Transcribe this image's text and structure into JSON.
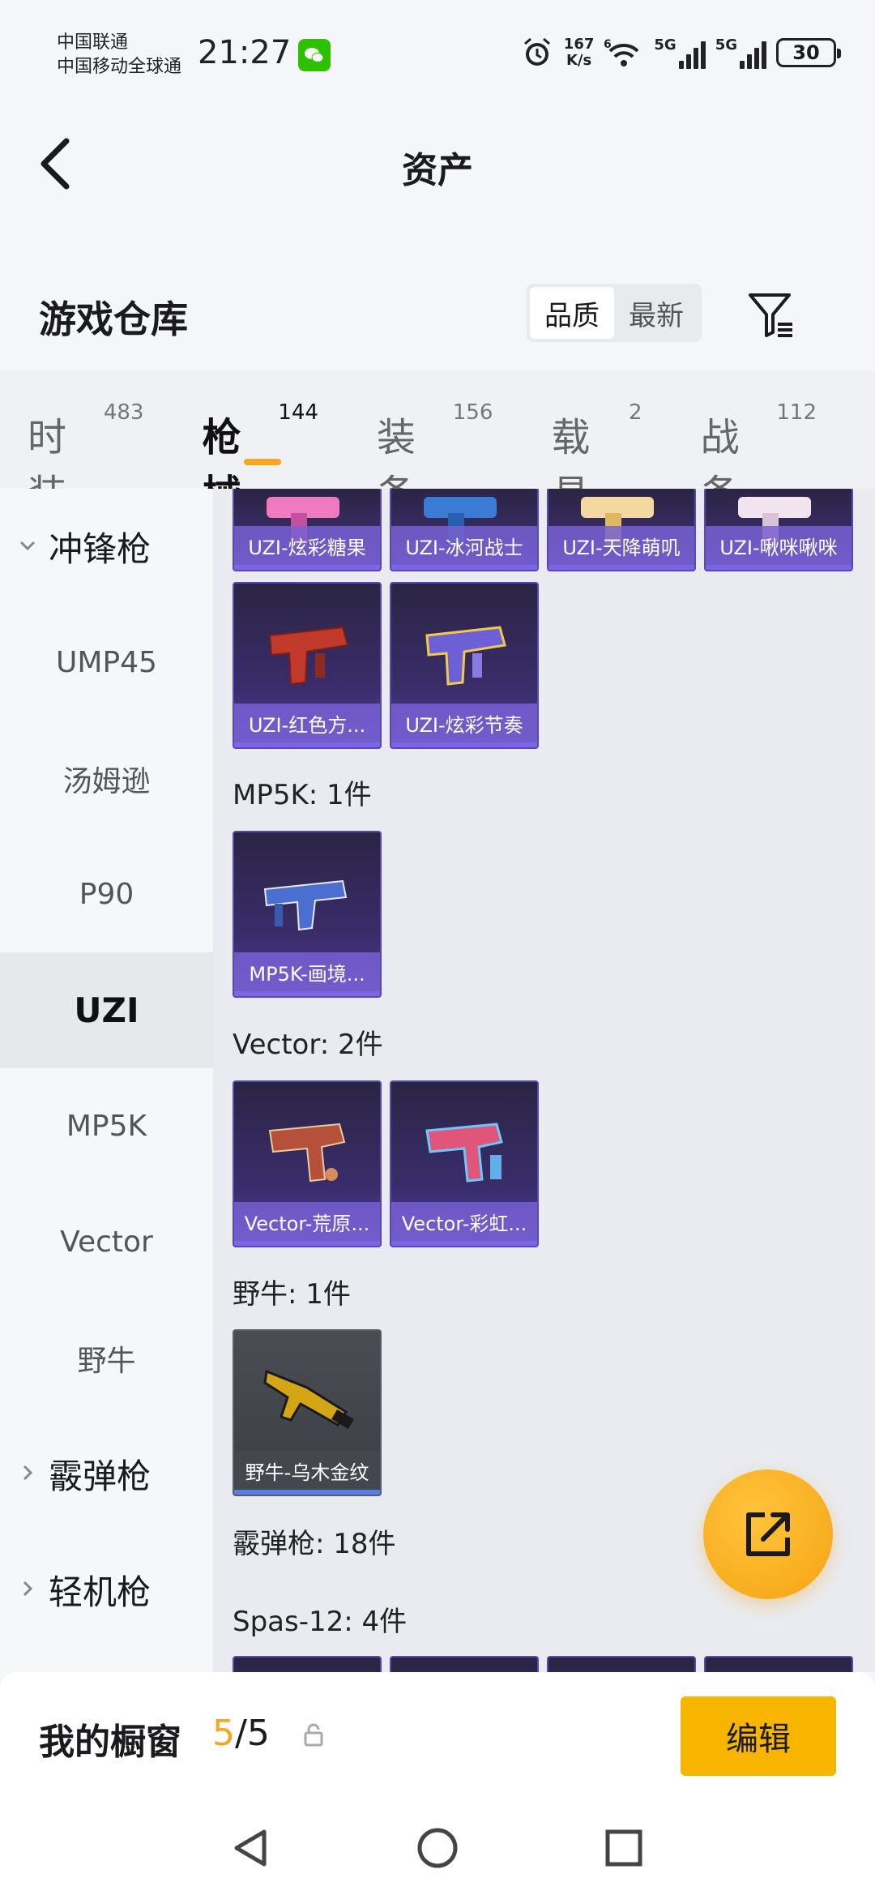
{
  "status_bar": {
    "carrier_1": "中国联通",
    "carrier_2": "中国移动全球通",
    "time": "21:27",
    "net_speed_value": "167",
    "net_speed_unit": "K/s",
    "sim1_type": "5G",
    "sim2_type": "5G",
    "wifi_sub": "6",
    "battery": "30",
    "icons": [
      "wechat-icon",
      "alarm-icon",
      "wifi-icon",
      "signal-icon",
      "battery-icon"
    ]
  },
  "header": {
    "title": "资产"
  },
  "warehouse": {
    "title": "游戏仓库",
    "sort_options": [
      "品质",
      "最新"
    ],
    "active_sort": "品质"
  },
  "tabs": [
    {
      "label": "时装",
      "count": "483"
    },
    {
      "label": "枪械",
      "count": "144"
    },
    {
      "label": "装备",
      "count": "156"
    },
    {
      "label": "载具",
      "count": "2"
    },
    {
      "label": "战备",
      "count": "112"
    }
  ],
  "active_tab": "枪械",
  "sidebar": {
    "items": [
      {
        "label": "冲锋枪",
        "type": "group"
      },
      {
        "label": "UMP45",
        "type": "item"
      },
      {
        "label": "汤姆逊",
        "type": "item"
      },
      {
        "label": "P90",
        "type": "item"
      },
      {
        "label": "UZI",
        "type": "item"
      },
      {
        "label": "MP5K",
        "type": "item"
      },
      {
        "label": "Vector",
        "type": "item"
      },
      {
        "label": "野牛",
        "type": "item"
      },
      {
        "label": "霰弹枪",
        "type": "group"
      },
      {
        "label": "轻机枪",
        "type": "group"
      }
    ],
    "active": "UZI"
  },
  "content": {
    "uzi_row1": [
      "UZI-炫彩糖果",
      "UZI-冰河战士",
      "UZI-天降萌叽",
      "UZI-啾咪啾咪"
    ],
    "uzi_row2": [
      "UZI-红色方...",
      "UZI-炫彩节奏"
    ],
    "mp5k_label": "MP5K: 1件",
    "mp5k_items": [
      "MP5K-画境..."
    ],
    "vector_label": "Vector: 2件",
    "vector_items": [
      "Vector-荒原...",
      "Vector-彩虹..."
    ],
    "bison_label": "野牛: 1件",
    "bison_items": [
      "野牛-乌木金纹"
    ],
    "shotgun_label": "霰弹枪: 18件",
    "spas_label": "Spas-12: 4件"
  },
  "bottom": {
    "showcase_label": "我的橱窗",
    "showcase_current": "5",
    "showcase_total": "/5",
    "edit_label": "编辑"
  },
  "colors": {
    "accent": "#f5a623",
    "edit_button": "#f7b500",
    "card_purple": "#3a2d6c"
  }
}
